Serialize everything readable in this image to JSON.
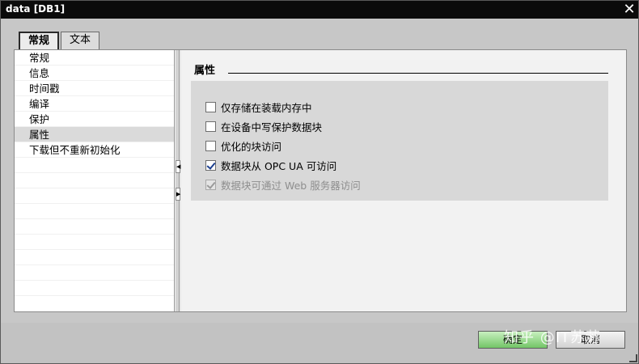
{
  "window": {
    "title": "data [DB1]"
  },
  "tabs": [
    {
      "label": "常规",
      "active": true
    },
    {
      "label": "文本",
      "active": false
    }
  ],
  "nav": {
    "items": [
      "常规",
      "信息",
      "时间戳",
      "编译",
      "保护",
      "属性",
      "下载但不重新初始化"
    ],
    "selected": "属性"
  },
  "panel": {
    "section_title": "属性",
    "options": [
      {
        "label": "仅存储在装载内存中",
        "checked": false,
        "disabled": false
      },
      {
        "label": "在设备中写保护数据块",
        "checked": false,
        "disabled": false
      },
      {
        "label": "优化的块访问",
        "checked": false,
        "disabled": false
      },
      {
        "label": "数据块从 OPC UA 可访问",
        "checked": true,
        "disabled": false
      },
      {
        "label": "数据块可通过 Web 服务器访问",
        "checked": true,
        "disabled": true
      }
    ]
  },
  "footer": {
    "ok_label": "确定",
    "cancel_label": "取消"
  },
  "watermark": "知乎 @IT苏苏",
  "icons": {
    "close": "close-icon",
    "collapse_left": "arrow-left-icon",
    "expand_right": "arrow-right-icon"
  },
  "colors": {
    "titlebar": "#0b0b0b",
    "ok_button": "#73c567",
    "checkbox_check": "#1c3f8f"
  }
}
